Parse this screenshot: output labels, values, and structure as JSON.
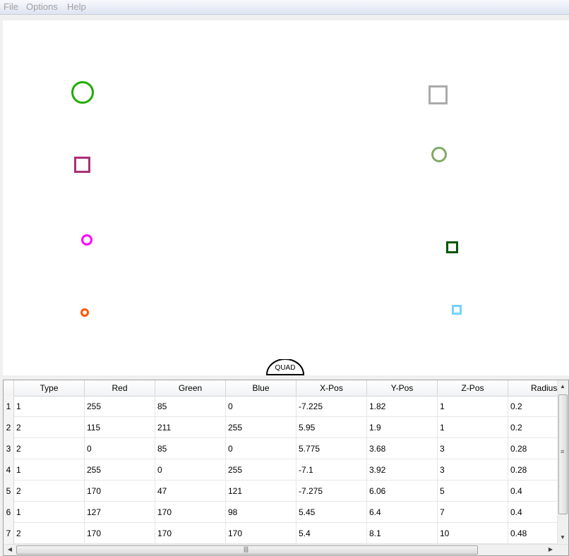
{
  "menu": {
    "file": "File",
    "options": "Options",
    "help": "Help"
  },
  "canvas": {
    "marker_label": "QUAD",
    "shapes": [
      {
        "name": "green-circle",
        "shape": "circle",
        "color": "#22aa00"
      },
      {
        "name": "gray-square",
        "shape": "square",
        "color": "#aaaaaa"
      },
      {
        "name": "magenta-purple-square",
        "shape": "square",
        "color": "#aa2f79"
      },
      {
        "name": "sage-circle",
        "shape": "circle",
        "color": "#7faa62"
      },
      {
        "name": "magenta-circle",
        "shape": "circle",
        "color": "#ff00ff"
      },
      {
        "name": "dark-green-square",
        "shape": "square",
        "color": "#005500"
      },
      {
        "name": "orange-circle",
        "shape": "circle",
        "color": "#ff5500"
      },
      {
        "name": "light-blue-square",
        "shape": "square",
        "color": "#73d3ff"
      }
    ]
  },
  "table": {
    "columns": [
      "Type",
      "Red",
      "Green",
      "Blue",
      "X-Pos",
      "Y-Pos",
      "Z-Pos",
      "Radius"
    ],
    "rows": [
      {
        "num": "1",
        "cells": [
          "1",
          "255",
          "85",
          "0",
          "-7.225",
          "1.82",
          "1",
          "0.2"
        ]
      },
      {
        "num": "2",
        "cells": [
          "2",
          "115",
          "211",
          "255",
          "5.95",
          "1.9",
          "1",
          "0.2"
        ]
      },
      {
        "num": "3",
        "cells": [
          "2",
          "0",
          "85",
          "0",
          "5.775",
          "3.68",
          "3",
          "0.28"
        ]
      },
      {
        "num": "4",
        "cells": [
          "1",
          "255",
          "0",
          "255",
          "-7.1",
          "3.92",
          "3",
          "0.28"
        ]
      },
      {
        "num": "5",
        "cells": [
          "2",
          "170",
          "47",
          "121",
          "-7.275",
          "6.06",
          "5",
          "0.4"
        ]
      },
      {
        "num": "6",
        "cells": [
          "1",
          "127",
          "170",
          "98",
          "5.45",
          "6.4",
          "7",
          "0.4"
        ]
      },
      {
        "num": "7",
        "cells": [
          "2",
          "170",
          "170",
          "170",
          "5.4",
          "8.1",
          "10",
          "0.48"
        ]
      }
    ]
  }
}
